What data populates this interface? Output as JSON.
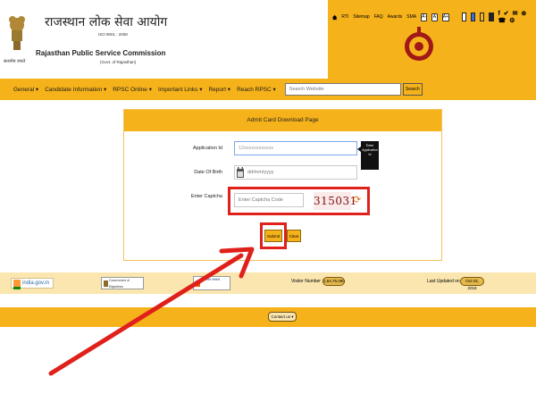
{
  "header": {
    "title_hindi": "राजस्थान लोक सेवा आयोग",
    "iso": "ISO 9001 : 2008",
    "title_en": "Rajasthan Public Service Commission",
    "govt": "(Govt. of Rajasthan)",
    "emblem_caption": "सत्यमेव जयते"
  },
  "topbar": {
    "links": [
      "RTI",
      "Sitemap",
      "FAQ",
      "Awards",
      "SMA"
    ],
    "font_buttons": [
      "A-",
      "A",
      "A+"
    ],
    "social": "f ✔ ✉ ⊕ ☎ ⚙"
  },
  "nav": {
    "items": [
      "General ▾",
      "Candidate Information ▾",
      "RPSC Online ▾",
      "Important Links ▾",
      "Report ▾",
      "Reach RPSC ▾"
    ],
    "search_placeholder": "Search Website",
    "search_button": "Search"
  },
  "form": {
    "title": "Admit Card Download Page",
    "application_label": "Application Id",
    "application_value": "12xxxxxxxxxxxx",
    "tooltip": "Enter Application Id",
    "dob_label": "Date Of Birth",
    "dob_placeholder": "dd/mm/yyyy",
    "captcha_label": "Enter Captcha",
    "captcha_placeholder": "Enter Captcha Code",
    "captcha_code": "315031",
    "submit": "Submit",
    "clear": "Clear"
  },
  "footer": {
    "india_gov": "india.gov.in",
    "gov_raj": "Government of Rajasthan",
    "other_logo": "राजस्थान सरकार",
    "visitor_label": "Visitor Number :",
    "visitor_value": "1,64,76,090",
    "updated_label": "Last Updated on :",
    "updated_value": "Oct 03, 2018",
    "contact": "Contact us ▾"
  },
  "colors": {
    "accent": "#f6b21a",
    "highlight": "#e0201a"
  }
}
